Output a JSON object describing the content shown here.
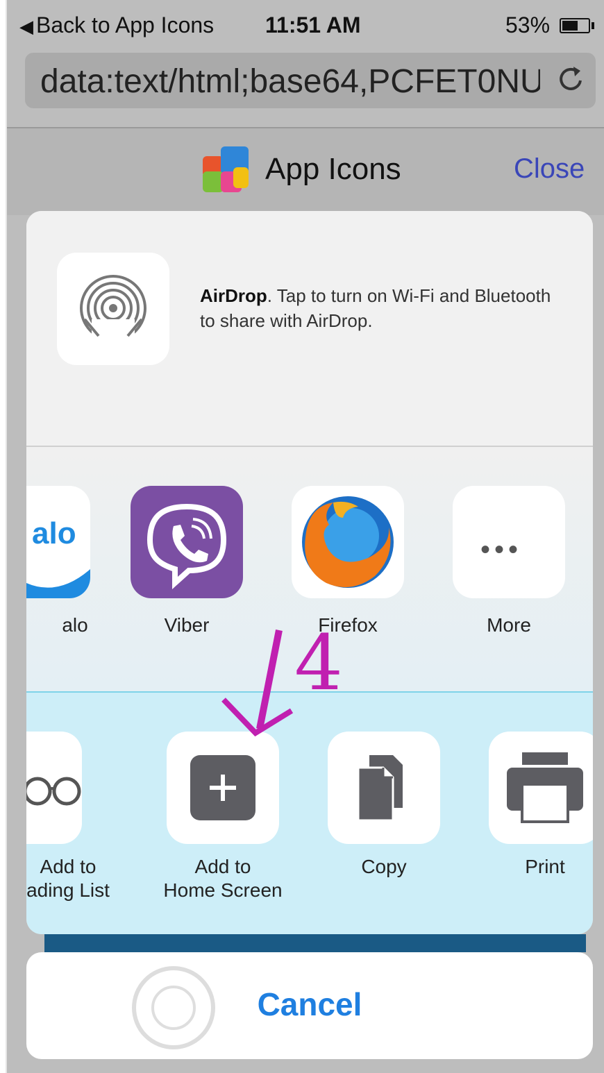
{
  "status_bar": {
    "back_label": "Back to App Icons",
    "time": "11:51 AM",
    "battery": "53%"
  },
  "address_bar": {
    "url": "data:text/html;base64,PCFET0NU\\"
  },
  "nav": {
    "title": "App Icons",
    "close_label": "Close"
  },
  "share_sheet": {
    "airdrop": {
      "bold": "AirDrop",
      "text": ". Tap to turn on Wi-Fi and Bluetooth to share with AirDrop."
    },
    "apps": [
      {
        "label": "alo",
        "icon": "zalo-icon"
      },
      {
        "label": "Viber",
        "icon": "viber-icon"
      },
      {
        "label": "Firefox",
        "icon": "firefox-icon"
      },
      {
        "label": "More",
        "icon": "more-icon"
      }
    ],
    "actions": [
      {
        "label_line1": "Add to",
        "label_line2": "ading List",
        "icon": "glasses-icon"
      },
      {
        "label_line1": "Add to",
        "label_line2": "Home Screen",
        "icon": "add-square-icon"
      },
      {
        "label_line1": "Copy",
        "label_line2": "",
        "icon": "copy-icon"
      },
      {
        "label_line1": "Print",
        "label_line2": "",
        "icon": "print-icon"
      }
    ],
    "cancel_label": "Cancel"
  },
  "annotation": {
    "step_number": "4",
    "color": "#c020b0"
  },
  "colors": {
    "link_blue": "#1f7fe0",
    "close_blue": "#3a46b8",
    "viber_purple": "#7b4fa3"
  }
}
